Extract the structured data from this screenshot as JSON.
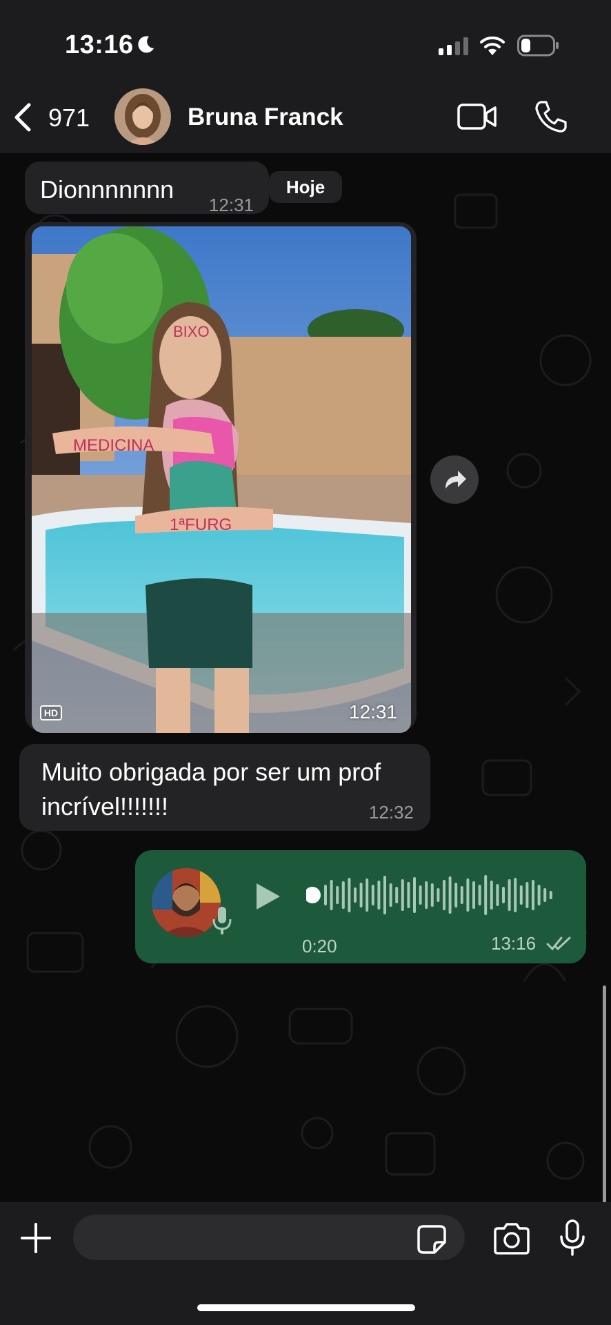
{
  "status": {
    "time": "13:16"
  },
  "header": {
    "back_count": "971",
    "contact_name": "Bruna Franck"
  },
  "messages": [
    {
      "type": "text",
      "direction": "in",
      "text": "Dionnnnnnn",
      "time": "12:31"
    },
    {
      "type": "image",
      "direction": "in",
      "badge": "HD",
      "time": "12:31",
      "forehead_text": "BIXO",
      "arm_text_1": "MEDICINA",
      "arm_text_2": "1ªFURG"
    },
    {
      "type": "text",
      "direction": "in",
      "text": "Muito obrigada por ser um prof incrível!!!!!!!",
      "time": "12:32"
    },
    {
      "type": "voice",
      "direction": "out",
      "duration": "0:20",
      "time": "13:16",
      "status": "double-tick-read"
    }
  ],
  "date_chip": "Hoje",
  "input": {
    "placeholder": ""
  },
  "colors": {
    "outgoing_bubble": "#1c5a3b",
    "incoming_bubble": "#232325",
    "bar": "#1c1c1e"
  }
}
